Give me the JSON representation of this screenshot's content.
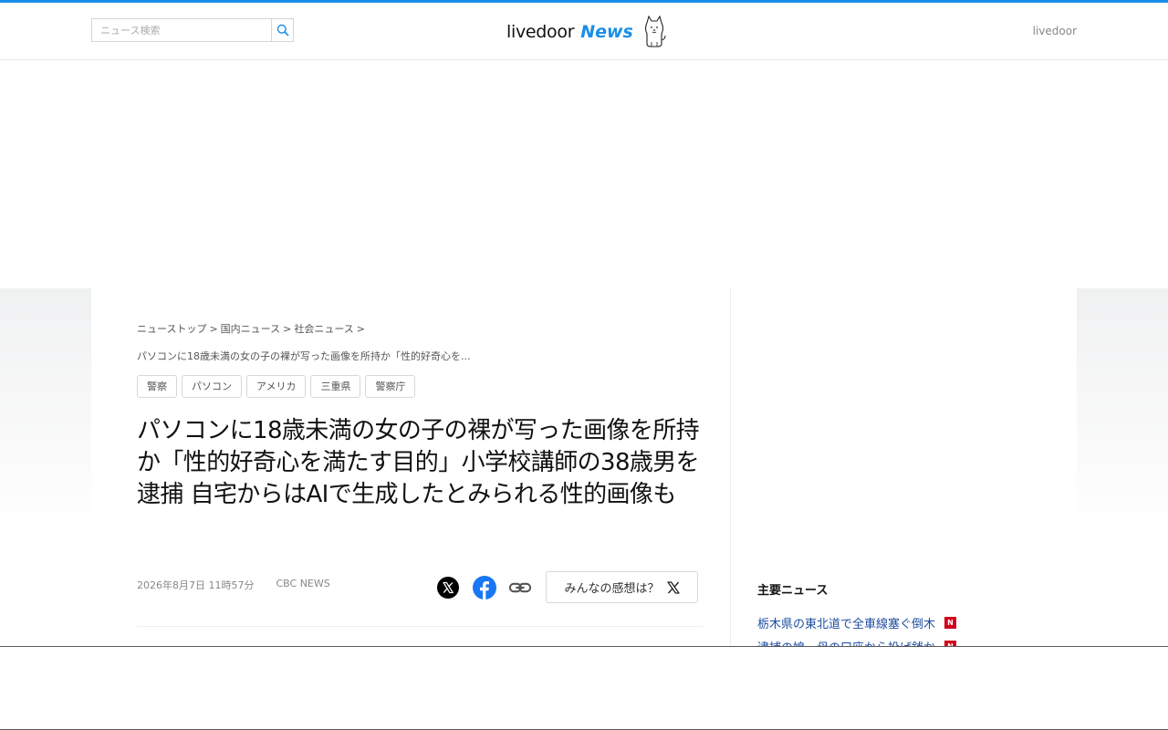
{
  "header": {
    "search_placeholder": "ニュース検索",
    "logo_text": "livedoor",
    "logo_news": "News",
    "right_link": "livedoor"
  },
  "breadcrumb": {
    "items": [
      "ニューストップ",
      "国内ニュース",
      "社会ニュース"
    ],
    "separator": ">",
    "current": "パソコンに18歳未満の女の子の裸が写った画像を所持か「性的好奇心を..."
  },
  "tags": [
    "警察",
    "パソコン",
    "アメリカ",
    "三重県",
    "警察庁"
  ],
  "article": {
    "title": "パソコンに18歳未満の女の子の裸が写った画像を所持か「性的好奇心を満たす目的」小学校講師の38歳男を逮捕 自宅からはAIで生成したとみられる性的画像も",
    "date": "2026年8月7日 11時57分",
    "source": "CBC NEWS"
  },
  "share": {
    "kansou_label": "みんなの感想は？"
  },
  "sidebar": {
    "heading": "主要ニュース",
    "items": [
      {
        "label": "栃木県の東北道で全車線塞ぐ倒木",
        "badge": "N"
      },
      {
        "label": "逮捕の娘、母の口座から投げ銭か",
        "badge": "N"
      }
    ]
  },
  "colors": {
    "accent": "#1a8ee8",
    "link": "#1e4ea0",
    "badge": "#d0021b"
  }
}
